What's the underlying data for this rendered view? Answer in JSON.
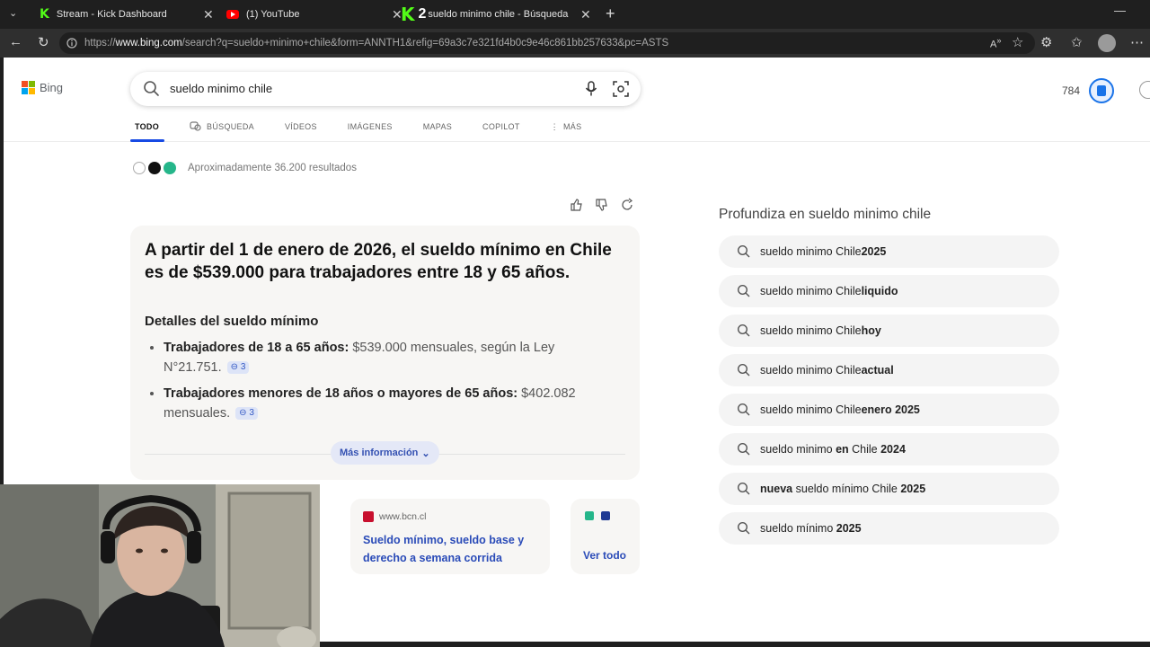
{
  "tabs": [
    {
      "title": "Stream - Kick Dashboard",
      "icon": "kick-icon"
    },
    {
      "title": "(1) YouTube",
      "icon": "youtube-icon"
    },
    {
      "title": "sueldo minimo chile - Búsqueda",
      "icon": "kick-icon",
      "badge": "2",
      "active": true
    }
  ],
  "address": {
    "url_prefix": "https://",
    "url_host": "www.bing.com",
    "url_rest": "/search?q=sueldo+minimo+chile&form=ANNTH1&refig=69a3c7e321fd4b0c9e46c861bb257633&pc=ASTS"
  },
  "header": {
    "logo_text": "Bing",
    "query": "sueldo minimo chile",
    "points": "784"
  },
  "scopes": [
    {
      "label": "TODO",
      "active": true
    },
    {
      "label": "BÚSQUEDA",
      "icon": "copilot-search-icon"
    },
    {
      "label": "VÍDEOS"
    },
    {
      "label": "IMÁGENES"
    },
    {
      "label": "MAPAS"
    },
    {
      "label": "COPILOT"
    },
    {
      "label": "MÁS",
      "icon": "more-vertical-icon"
    }
  ],
  "results": {
    "count_text": "Aproximadamente 36.200 resultados"
  },
  "answer": {
    "headline": "A partir del 1 de enero de 2026, el sueldo mínimo en Chile es de $539.000 para trabajadores entre 18 y 65 años.",
    "subheading": "Detalles del sueldo mínimo",
    "bullets": [
      {
        "bold": "Trabajadores de 18 a 65 años:",
        "text": " $539.000 mensuales, según la Ley N°21.751.",
        "cites": "3"
      },
      {
        "bold": "Trabajadores menores de 18 años o mayores de 65 años:",
        "text": " $402.082 mensuales.",
        "cites": "3"
      }
    ],
    "more_label": "Más información"
  },
  "cards": [
    {
      "source": "www.bcn.cl",
      "title": "Sueldo mínimo, sueldo base y derecho a semana corrida"
    },
    {
      "label": "Ver todo"
    }
  ],
  "sidebar": {
    "title": "Profundiza en sueldo minimo chile",
    "related": [
      {
        "normal": "sueldo minimo Chile ",
        "bold": "2025"
      },
      {
        "normal": "sueldo minimo Chile ",
        "bold": "liquido"
      },
      {
        "normal": "sueldo minimo Chile ",
        "bold": "hoy"
      },
      {
        "normal": "sueldo minimo Chile ",
        "bold": "actual"
      },
      {
        "normal": "sueldo minimo Chile ",
        "bold": "enero 2025"
      },
      {
        "pre": "sueldo minimo ",
        "bold1": "en",
        "mid": " Chile ",
        "bold": "2024"
      },
      {
        "bold0": "nueva",
        "normal": " sueldo mínimo Chile ",
        "bold": "2025"
      },
      {
        "normal": "sueldo mínimo ",
        "bold": "2025"
      }
    ]
  },
  "colors": {
    "accent": "#174ae4",
    "link": "#2a4bb8",
    "kick_green": "#53fc18"
  }
}
